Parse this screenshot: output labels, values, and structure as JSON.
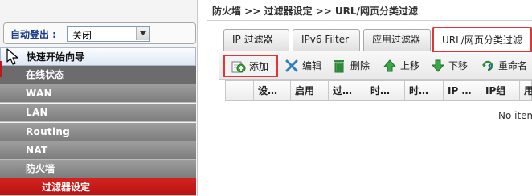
{
  "sidebar": {
    "auto_logout_label": "自动登出 :",
    "auto_logout_value": "关闭",
    "items": [
      {
        "label": "快速开始向导"
      },
      {
        "label": "在线状态"
      },
      {
        "label": "WAN"
      },
      {
        "label": "LAN"
      },
      {
        "label": "Routing"
      },
      {
        "label": "NAT"
      },
      {
        "label": "防火墙"
      },
      {
        "label": "过滤器设定"
      }
    ]
  },
  "main": {
    "breadcrumb": "防火墙 >> 过滤器设定 >> URL/网页分类过滤",
    "tabs": [
      {
        "label": "IP 过滤器"
      },
      {
        "label": "IPv6 Filter"
      },
      {
        "label": "应用过滤器"
      },
      {
        "label": "URL/网页分类过滤"
      }
    ],
    "toolbar": {
      "add": "添加",
      "edit": "编辑",
      "delete": "删除",
      "up": "上移",
      "down": "下移",
      "rename": "重命名"
    },
    "columns": [
      "设…",
      "启用",
      "过…",
      "时…",
      "时…",
      "IP …",
      "IP组",
      "用"
    ],
    "empty_text": "No item"
  },
  "colors": {
    "highlight_red": "#e2353a",
    "menu_gray": "#8a8a8a",
    "menu_active_red": "#c21b18",
    "title_blue": "#1a3a8a"
  }
}
